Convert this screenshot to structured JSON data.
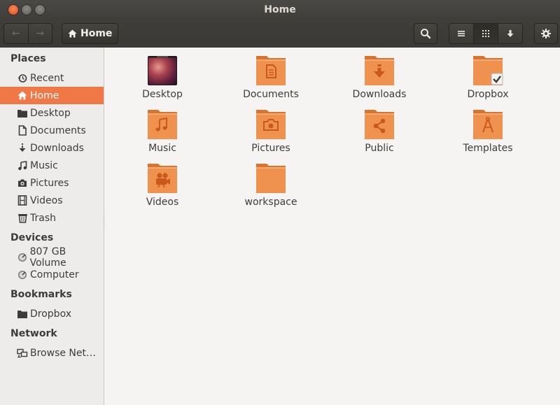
{
  "window": {
    "title": "Home"
  },
  "toolbar": {
    "back": "←",
    "forward": "→",
    "path_button": "Home"
  },
  "sidebar": {
    "places_heading": "Places",
    "places": [
      {
        "label": "Recent",
        "icon": "recent-icon"
      },
      {
        "label": "Home",
        "icon": "home-icon",
        "selected": true
      },
      {
        "label": "Desktop",
        "icon": "desktop-folder-icon"
      },
      {
        "label": "Documents",
        "icon": "document-icon"
      },
      {
        "label": "Downloads",
        "icon": "download-icon"
      },
      {
        "label": "Music",
        "icon": "music-icon"
      },
      {
        "label": "Pictures",
        "icon": "camera-icon"
      },
      {
        "label": "Videos",
        "icon": "film-icon"
      },
      {
        "label": "Trash",
        "icon": "trash-icon"
      }
    ],
    "devices_heading": "Devices",
    "devices": [
      {
        "label": "807 GB Volume",
        "icon": "drive-icon"
      },
      {
        "label": "Computer",
        "icon": "drive-icon"
      }
    ],
    "bookmarks_heading": "Bookmarks",
    "bookmarks": [
      {
        "label": "Dropbox",
        "icon": "folder-icon"
      }
    ],
    "network_heading": "Network",
    "network": [
      {
        "label": "Browse Net…",
        "icon": "network-icon"
      }
    ]
  },
  "files": [
    {
      "label": "Desktop",
      "icon": "desktop-folder-icon"
    },
    {
      "label": "Documents",
      "icon": "documents-folder-icon"
    },
    {
      "label": "Downloads",
      "icon": "downloads-folder-icon"
    },
    {
      "label": "Dropbox",
      "icon": "dropbox-folder-icon"
    },
    {
      "label": "Music",
      "icon": "music-folder-icon"
    },
    {
      "label": "Pictures",
      "icon": "pictures-folder-icon"
    },
    {
      "label": "Public",
      "icon": "public-folder-icon"
    },
    {
      "label": "Templates",
      "icon": "templates-folder-icon"
    },
    {
      "label": "Videos",
      "icon": "videos-folder-icon"
    },
    {
      "label": "workspace",
      "icon": "folder-icon"
    }
  ],
  "colors": {
    "accent": "#f07746",
    "folder": "#f0924f",
    "titlebar": "#3c3b37",
    "sidebar_bg": "#edecea",
    "content_bg": "#f5f4f2"
  }
}
